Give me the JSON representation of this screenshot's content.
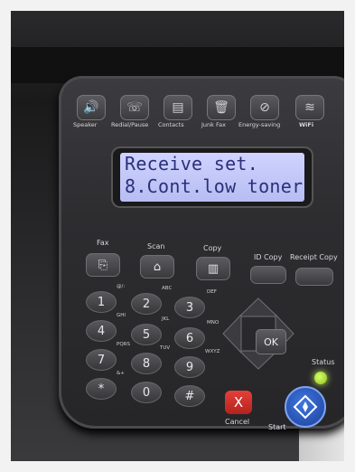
{
  "lcd": {
    "line1": "Receive set.",
    "line2": "8.Cont.low toner"
  },
  "top_buttons": [
    {
      "icon": "speaker-icon",
      "label": "Speaker"
    },
    {
      "icon": "redial-pause-icon",
      "label": "Redial/Pause"
    },
    {
      "icon": "contacts-icon",
      "label": "Contacts"
    },
    {
      "icon": "junk-fax-icon",
      "label": "Junk Fax"
    },
    {
      "icon": "energy-saving-icon",
      "label": "Energy-saving"
    },
    {
      "icon": "wifi-icon",
      "label": "WiFi"
    }
  ],
  "mode_buttons": {
    "fax": "Fax",
    "scan": "Scan",
    "copy": "Copy",
    "id_copy": "ID Copy",
    "receipt_copy": "Receipt Copy"
  },
  "keypad": [
    {
      "key": "1",
      "sub": "@/:"
    },
    {
      "key": "2",
      "sub": "ABC"
    },
    {
      "key": "3",
      "sub": "DEF"
    },
    {
      "key": "4",
      "sub": "GHI"
    },
    {
      "key": "5",
      "sub": "JKL"
    },
    {
      "key": "6",
      "sub": "MNO"
    },
    {
      "key": "7",
      "sub": "PQRS"
    },
    {
      "key": "8",
      "sub": "TUV"
    },
    {
      "key": "9",
      "sub": "WXYZ"
    },
    {
      "key": "*",
      "sub": "&+"
    },
    {
      "key": "0",
      "sub": ""
    },
    {
      "key": "#",
      "sub": ""
    }
  ],
  "nav": {
    "ok": "OK"
  },
  "status": {
    "label": "Status"
  },
  "cancel": {
    "label": "Cancel",
    "symbol": "X"
  },
  "start": {
    "label": "Start"
  }
}
